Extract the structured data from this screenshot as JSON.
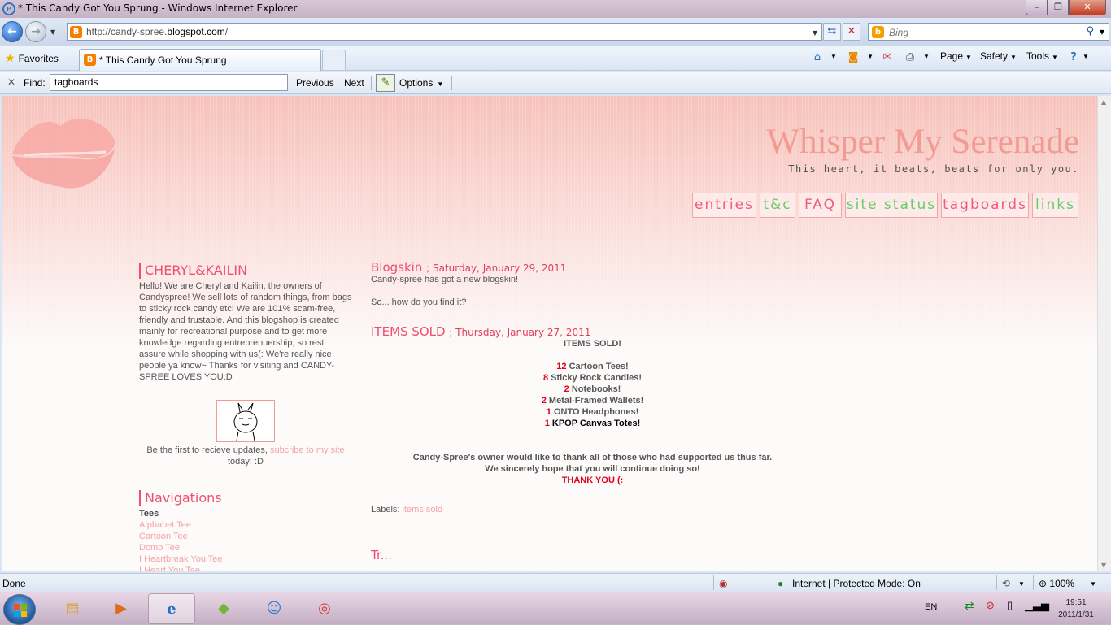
{
  "window": {
    "title": "* This Candy Got You Sprung - Windows Internet Explorer",
    "min_label": "–",
    "max_label": "❐",
    "close_label": "✕"
  },
  "nav": {
    "url_prefix": "http://candy-spree.",
    "url_domain": "blogspot.com",
    "url_suffix": "/",
    "search_placeholder": "Bing"
  },
  "favbar": {
    "favorites_label": "Favorites",
    "tab_label": "* This Candy Got You Sprung",
    "page_label": "Page",
    "safety_label": "Safety",
    "tools_label": "Tools"
  },
  "find": {
    "label": "Find:",
    "value": "tagboards",
    "previous": "Previous",
    "next": "Next",
    "options": "Options"
  },
  "site": {
    "title": "Whisper My Serenade",
    "subtitle": "This heart, it beats, beats for only you.",
    "menu": [
      "entries",
      "t&c",
      "FAQ",
      "site status",
      "tagboards",
      "links"
    ]
  },
  "sidebar": {
    "about_heading": "CHERYL&KAILIN",
    "about_text": "Hello! We are Cheryl and Kailin, the owners of Candyspree! We sell lots of random things, from bags to sticky rock candy etc! We are 101% scam-free, friendly and trustable. And this blogshop is created mainly for recreational purpose and to get more knowledge regarding entreprenuership, so rest assure while shopping with us(: We're really nice people ya know~ Thanks for visiting and CANDY-SPREE LOVES YOU:D",
    "subscribe_before": "Be the first to recieve updates,",
    "subscribe_link": "subcribe to my site",
    "subscribe_after": "today! :D",
    "nav_heading": "Navigations",
    "nav_group": "Tees",
    "nav_items": [
      "Alphabet Tee",
      "Cartoon Tee",
      "Domo Tee",
      "I Heartbreak You Tee",
      "I Heart You Tee"
    ]
  },
  "posts": {
    "p1_title": "Blogskin",
    "p1_date": "; Saturday, January 29, 2011",
    "p1_line1": "Candy-spree has got a new blogskin!",
    "p1_line2": "So... how do you find it?",
    "p2_title": "ITEMS SOLD",
    "p2_date": "; Thursday, January 27, 2011",
    "p2_heading": "ITEMS SOLD!",
    "items": [
      {
        "qty": "12",
        "name": "Cartoon Tees!"
      },
      {
        "qty": "8",
        "name": "Sticky Rock Candies!"
      },
      {
        "qty": "2",
        "name": "Notebooks!"
      },
      {
        "qty": "2",
        "name": "Metal-Framed Wallets!"
      },
      {
        "qty": "1",
        "name": "ONTO Headphones!"
      },
      {
        "qty": "1",
        "name": "KPOP Canvas Totes!"
      }
    ],
    "thanks1": "Candy-Spree's owner would like to thank all of those who had supported us thus far.",
    "thanks2": "We sincerely hope that you will continue doing so!",
    "thanks3": "THANK YOU (:",
    "labels_prefix": "Labels:",
    "labels_link": "items sold",
    "next_title_partial": "Tr..."
  },
  "status": {
    "text": "Done",
    "zone": "Internet | Protected Mode: On",
    "zoom": "100%"
  },
  "taskbar": {
    "lang": "EN",
    "time": "19:51",
    "date": "2011/1/31"
  }
}
